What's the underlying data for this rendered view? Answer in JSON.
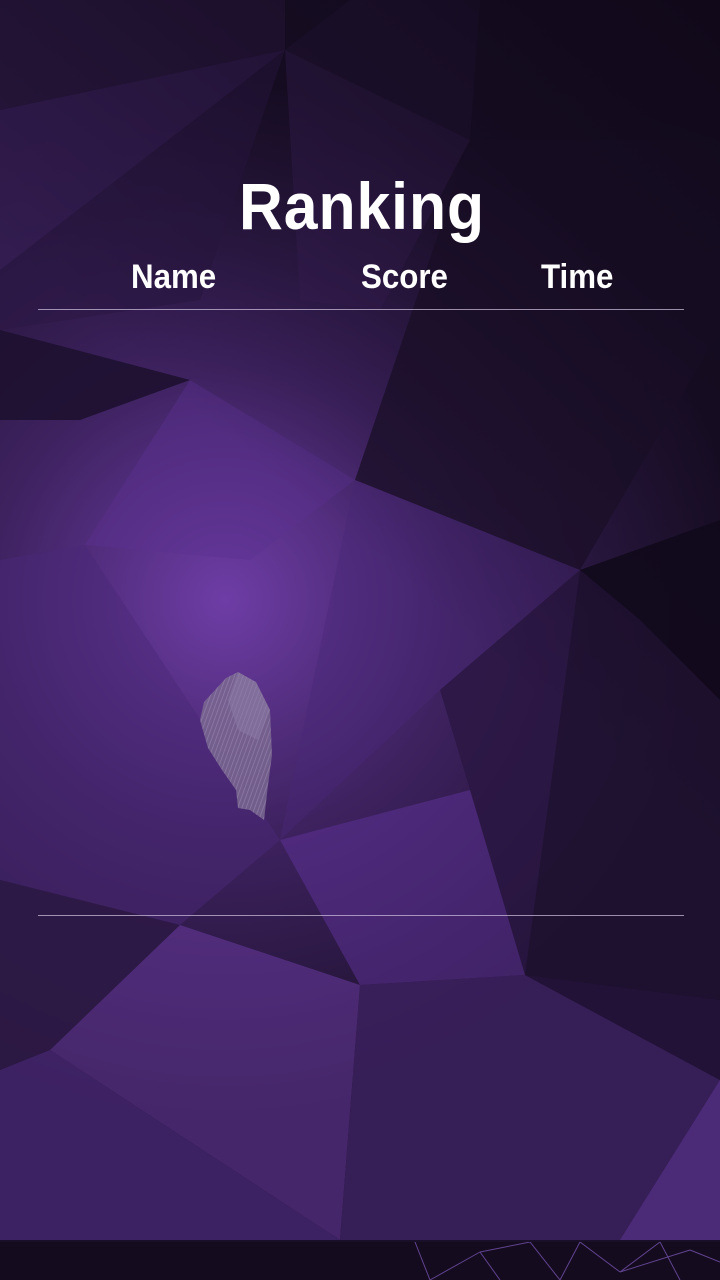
{
  "screen": {
    "title": "Ranking",
    "columns": {
      "name": "Name",
      "score": "Score",
      "time": "Time"
    },
    "entries": []
  },
  "colors": {
    "background_dark": "#140b1e",
    "background_purple": "#6a3a9e",
    "text": "#ffffff",
    "divider": "#c8b9d7"
  },
  "icons": {
    "loading": "crystal-loading-icon"
  }
}
